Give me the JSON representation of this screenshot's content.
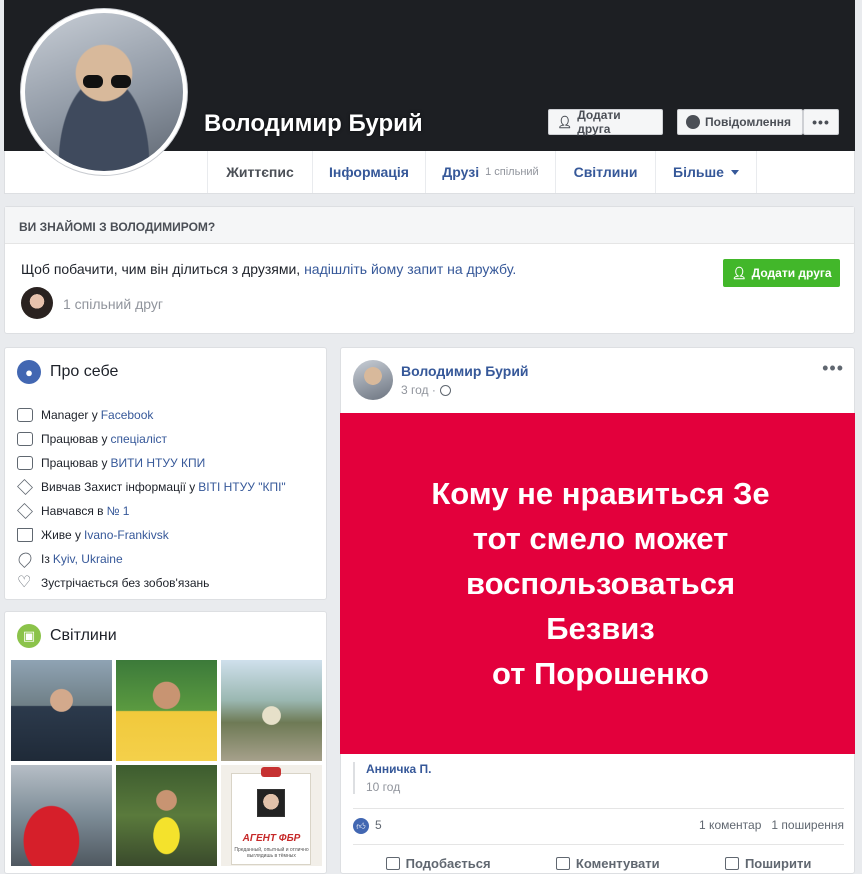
{
  "profile": {
    "name": "Володимир Бурий",
    "add_friend_label": "Додати друга",
    "message_label": "Повідомлення",
    "more_label": "•••"
  },
  "nav": {
    "timeline": "Життєпис",
    "about": "Інформація",
    "friends": "Друзі",
    "friends_sub": "1 спільний",
    "photos": "Світлини",
    "more": "Більше"
  },
  "know_box": {
    "heading": "ВИ ЗНАЙОМІ З ВОЛОДИМИРОМ?",
    "text_prefix": "Щоб побачити, чим він ділиться з друзями, ",
    "text_link": "надішліть йому запит на дружбу.",
    "button_label": "Додати друга",
    "mutual_label": "1 спільний друг"
  },
  "about": {
    "title": "Про себе",
    "items": [
      {
        "icon": "briefcase-icon",
        "text": "Manager у",
        "link": "Facebook"
      },
      {
        "icon": "briefcase-icon",
        "text": "Працював у",
        "link": "спеціаліст"
      },
      {
        "icon": "briefcase-icon",
        "text": "Працював у",
        "link": "ВИТИ НТУУ КПИ"
      },
      {
        "icon": "graduation-cap-icon",
        "text": "Вивчав Захист інформації у",
        "link": "ВІТІ НТУУ \"КПІ\""
      },
      {
        "icon": "graduation-cap-icon",
        "text": "Навчався в",
        "link": "№ 1"
      },
      {
        "icon": "home-icon",
        "text": "Живе у",
        "link": "Ivano-Frankivsk"
      },
      {
        "icon": "location-pin-icon",
        "text": "Із",
        "link": "Kyiv, Ukraine"
      },
      {
        "icon": "heart-icon",
        "text": "Зустрічається без зобов'язань",
        "link": ""
      }
    ]
  },
  "photos": {
    "title": "Світлини",
    "agent_caption": "АГЕНТ ФБР",
    "agent_small": "Преданный, опытный и отлично выглядишь в тёмных"
  },
  "post": {
    "author": "Володимир Бурий",
    "time": "3 год ·",
    "image_lines": [
      "Кому  не нравиться Зе",
      "тот смело может",
      "воспользоваться",
      "Безвиз",
      "от Порошенко"
    ],
    "shared_by_name": "Анничка П.",
    "shared_by_time": "10 год",
    "likes": "5",
    "comments_count": "1 коментар",
    "shares_count": "1 поширення",
    "like_label": "Подобається",
    "comment_label": "Коментувати",
    "share_label": "Поширити"
  },
  "colors": {
    "brand_blue": "#4267b2",
    "link_blue": "#365899",
    "green": "#42b72a",
    "post_red": "#e3003c"
  }
}
